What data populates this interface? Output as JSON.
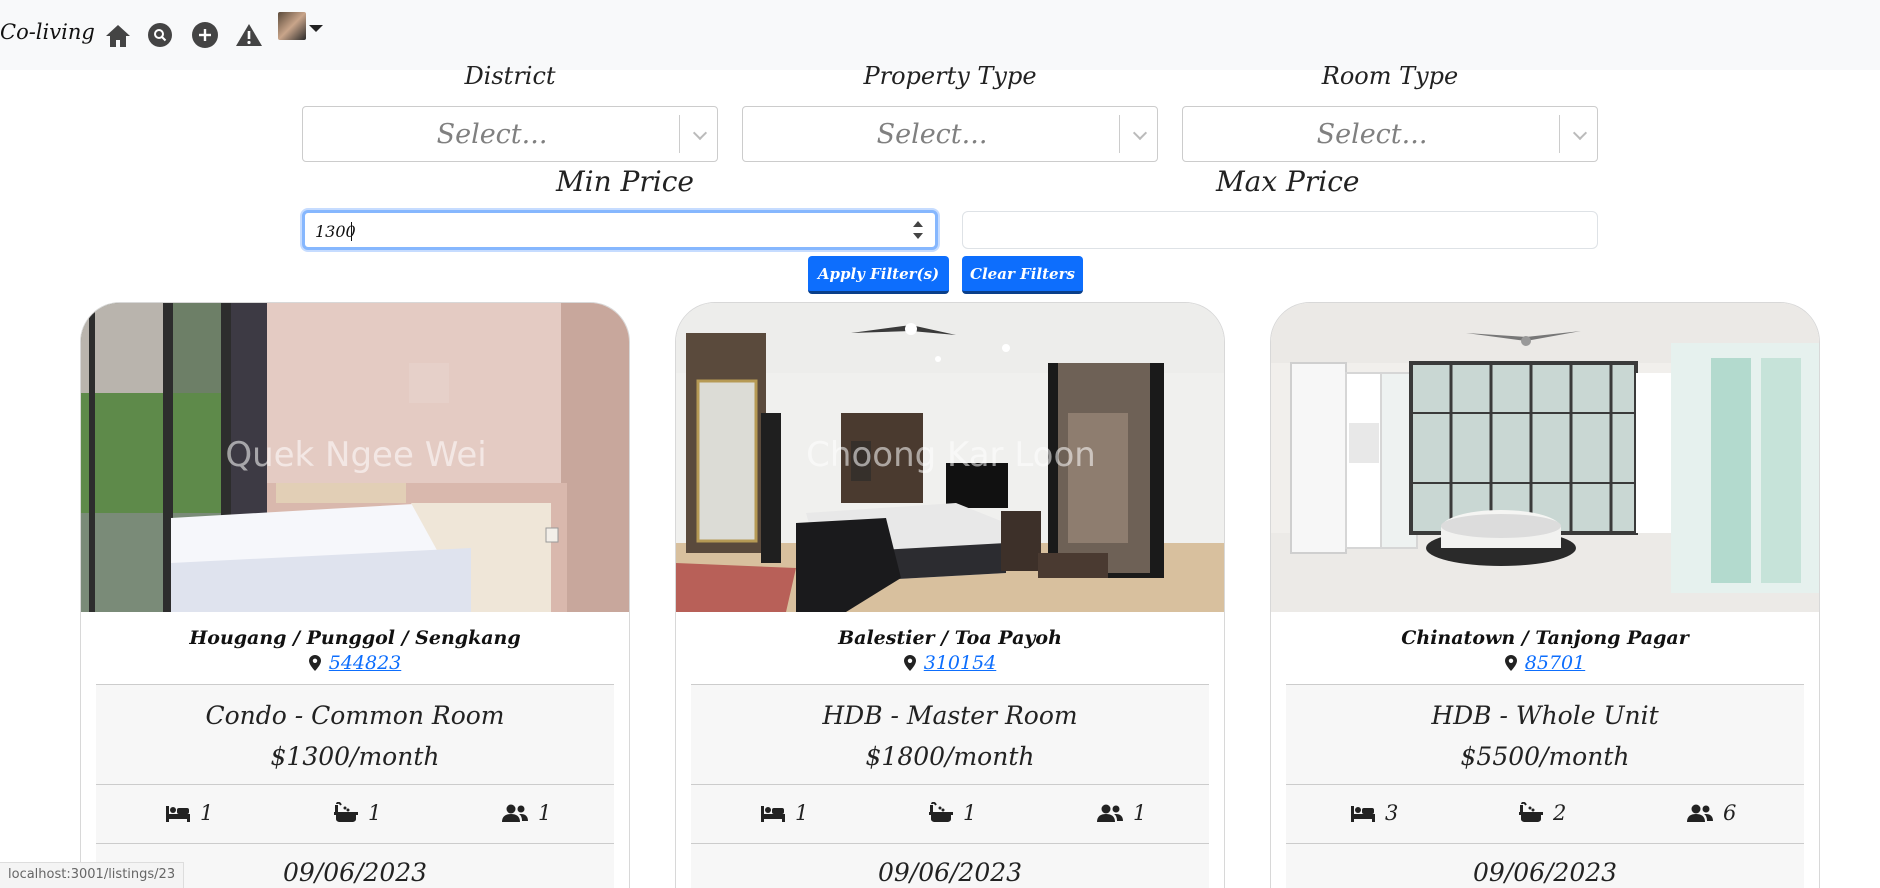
{
  "navbar": {
    "brand": "Co-living",
    "icons": [
      "home-icon",
      "search-icon",
      "add-icon",
      "alert-icon"
    ]
  },
  "filters": {
    "district_label": "District",
    "property_type_label": "Property Type",
    "room_type_label": "Room Type",
    "select_placeholder": "Select...",
    "min_price_label": "Min Price",
    "max_price_label": "Max Price",
    "min_price_value": "1300",
    "max_price_value": "",
    "apply_label": "Apply Filter(s)",
    "clear_label": "Clear Filters"
  },
  "listings": [
    {
      "watermark": "Quek Ngee Wei",
      "district": "Hougang / Punggol / Sengkang",
      "postal": "544823",
      "room_type": "Condo - Common Room",
      "price": "$1300/month",
      "bedrooms": "1",
      "bathrooms": "1",
      "occupants": "1",
      "date": "09/06/2023"
    },
    {
      "watermark": "Choong Kar Loon",
      "district": "Balestier / Toa Payoh",
      "postal": "310154",
      "room_type": "HDB - Master Room",
      "price": "$1800/month",
      "bedrooms": "1",
      "bathrooms": "1",
      "occupants": "1",
      "date": "09/06/2023"
    },
    {
      "watermark": "",
      "district": "Chinatown / Tanjong Pagar",
      "postal": "85701",
      "room_type": "HDB - Whole Unit",
      "price": "$5500/month",
      "bedrooms": "3",
      "bathrooms": "2",
      "occupants": "6",
      "date": "09/06/2023"
    }
  ],
  "status_url": "localhost:3001/listings/23",
  "colors": {
    "primary": "#0d6efd",
    "navbar_bg": "#f8f9fa",
    "info_bg": "#f7f7f7"
  }
}
